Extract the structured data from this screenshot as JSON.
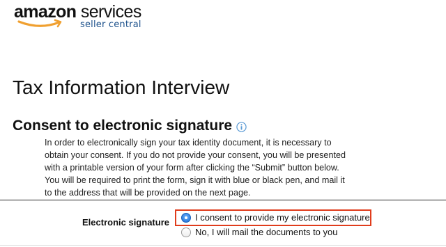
{
  "header": {
    "logo_brand": "amazon",
    "logo_services": "services",
    "logo_subtitle": "seller central"
  },
  "page_title": "Tax Information Interview",
  "section": {
    "heading": "Consent to electronic signature",
    "info_icon": "info-icon",
    "lines": [
      "In order to electronically sign your tax identity document, it is necessary to",
      "obtain your consent. If you do not provide your consent, you will be presented",
      "with a printable version of your form after clicking the “Submit” button below.",
      "You will be required to print the form, sign it with blue or black pen, and mail it",
      "to the address that will be provided on the next page."
    ]
  },
  "form": {
    "field_label": "Electronic signature",
    "options": [
      {
        "label": "I consent to provide my electronic signature",
        "selected": true
      },
      {
        "label": "No, I will mail the documents to you",
        "selected": false
      }
    ],
    "highlight_color": "#e03c1c"
  },
  "colors": {
    "logo_accent": "#f0a030",
    "subtitle": "#1a4f8a",
    "info_icon": "#5b9bd5",
    "radio_selected": "#2f7fe0"
  }
}
